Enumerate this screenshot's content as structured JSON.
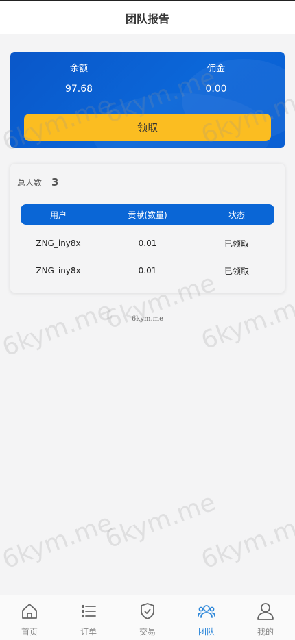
{
  "header": {
    "title": "团队报告"
  },
  "balance": {
    "balance_label": "余额",
    "balance_value": "97.68",
    "commission_label": "佣金",
    "commission_value": "0.00",
    "claim_label": "领取"
  },
  "team": {
    "total_label": "总人数",
    "total_count": "3",
    "columns": [
      "用户",
      "贡献(数量)",
      "状态"
    ],
    "rows": [
      {
        "user": "ZNG_iny8x",
        "amount": "0.01",
        "status": "已领取"
      },
      {
        "user": "ZNG_iny8x",
        "amount": "0.01",
        "status": "已领取"
      }
    ]
  },
  "watermark": {
    "text": "6kym.me",
    "center_text": "6kym.me"
  },
  "tabs": [
    {
      "label": "首页",
      "icon": "home-icon"
    },
    {
      "label": "订单",
      "icon": "list-icon"
    },
    {
      "label": "交易",
      "icon": "shield-check-icon"
    },
    {
      "label": "团队",
      "icon": "team-icon",
      "active": true
    },
    {
      "label": "我的",
      "icon": "user-icon"
    }
  ],
  "colors": {
    "primary": "#0a66d6",
    "accent": "#fbbd21",
    "active_tab": "#2b86d9"
  }
}
